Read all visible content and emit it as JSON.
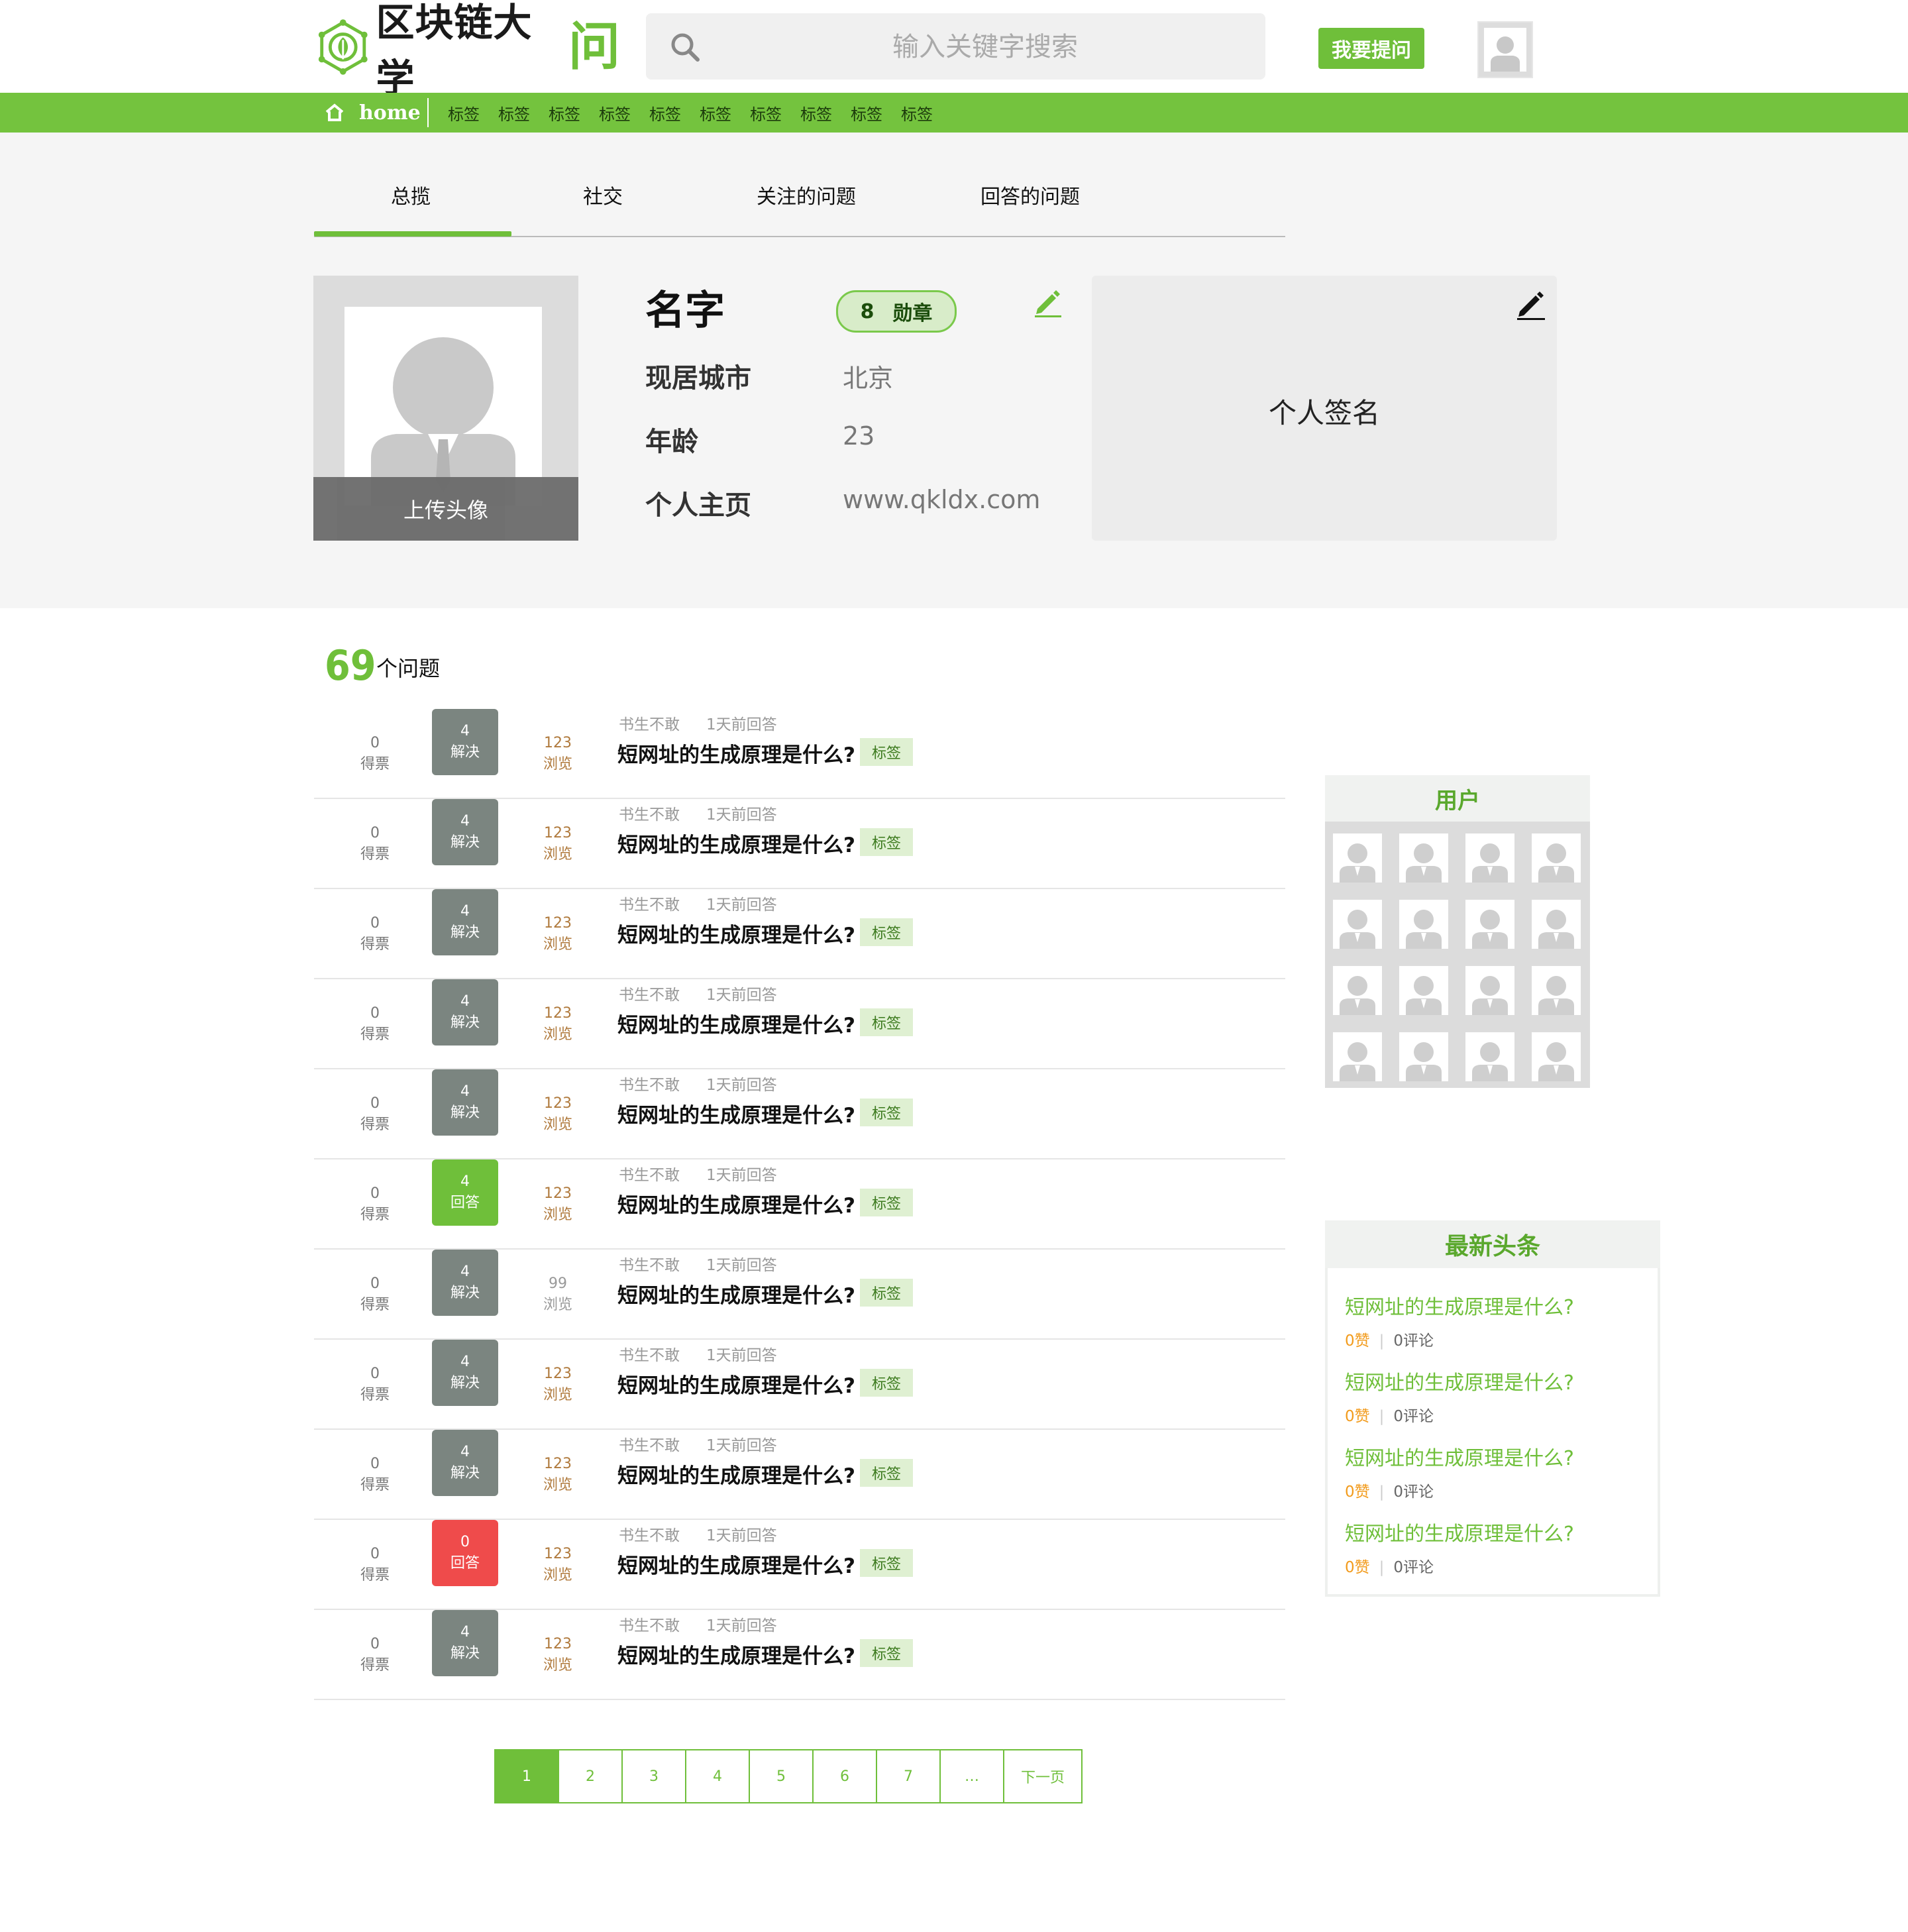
{
  "header": {
    "logo_text": "区块链大学",
    "logo_accent": "问",
    "search_placeholder": "输入关键字搜索",
    "ask_button": "我要提问"
  },
  "nav": {
    "home_label": "home",
    "tags": [
      "标签",
      "标签",
      "标签",
      "标签",
      "标签",
      "标签",
      "标签",
      "标签",
      "标签",
      "标签"
    ]
  },
  "tabs": [
    "总揽",
    "社交",
    "关注的问题",
    "回答的问题"
  ],
  "profile": {
    "name": "名字",
    "badge_count": "8",
    "badge_label": "勋章",
    "upload_label": "上传头像",
    "city_label": "现居城市",
    "city_value": "北京",
    "age_label": "年龄",
    "age_value": "23",
    "homepage_label": "个人主页",
    "homepage_value": "www.qkldx.com",
    "signature": "个人签名"
  },
  "questions": {
    "count": "69",
    "count_label": "个问题",
    "items": [
      {
        "votes": "0",
        "votes_label": "得票",
        "answers": "4",
        "answers_label": "解决",
        "status": "solved",
        "views": "123",
        "views_label": "浏览",
        "author": "书生不敢",
        "time": "1天前回答",
        "title": "短网址的生成原理是什么?",
        "tag": "标签"
      },
      {
        "votes": "0",
        "votes_label": "得票",
        "answers": "4",
        "answers_label": "解决",
        "status": "solved",
        "views": "123",
        "views_label": "浏览",
        "author": "书生不敢",
        "time": "1天前回答",
        "title": "短网址的生成原理是什么?",
        "tag": "标签"
      },
      {
        "votes": "0",
        "votes_label": "得票",
        "answers": "4",
        "answers_label": "解决",
        "status": "solved",
        "views": "123",
        "views_label": "浏览",
        "author": "书生不敢",
        "time": "1天前回答",
        "title": "短网址的生成原理是什么?",
        "tag": "标签"
      },
      {
        "votes": "0",
        "votes_label": "得票",
        "answers": "4",
        "answers_label": "解决",
        "status": "solved",
        "views": "123",
        "views_label": "浏览",
        "author": "书生不敢",
        "time": "1天前回答",
        "title": "短网址的生成原理是什么?",
        "tag": "标签"
      },
      {
        "votes": "0",
        "votes_label": "得票",
        "answers": "4",
        "answers_label": "解决",
        "status": "solved",
        "views": "123",
        "views_label": "浏览",
        "author": "书生不敢",
        "time": "1天前回答",
        "title": "短网址的生成原理是什么?",
        "tag": "标签"
      },
      {
        "votes": "0",
        "votes_label": "得票",
        "answers": "4",
        "answers_label": "回答",
        "status": "answered",
        "views": "123",
        "views_label": "浏览",
        "author": "书生不敢",
        "time": "1天前回答",
        "title": "短网址的生成原理是什么?",
        "tag": "标签"
      },
      {
        "votes": "0",
        "votes_label": "得票",
        "answers": "4",
        "answers_label": "解决",
        "status": "solved",
        "views": "99",
        "views_label": "浏览",
        "author": "书生不敢",
        "time": "1天前回答",
        "title": "短网址的生成原理是什么?",
        "tag": "标签"
      },
      {
        "votes": "0",
        "votes_label": "得票",
        "answers": "4",
        "answers_label": "解决",
        "status": "solved",
        "views": "123",
        "views_label": "浏览",
        "author": "书生不敢",
        "time": "1天前回答",
        "title": "短网址的生成原理是什么?",
        "tag": "标签"
      },
      {
        "votes": "0",
        "votes_label": "得票",
        "answers": "4",
        "answers_label": "解决",
        "status": "solved",
        "views": "123",
        "views_label": "浏览",
        "author": "书生不敢",
        "time": "1天前回答",
        "title": "短网址的生成原理是什么?",
        "tag": "标签"
      },
      {
        "votes": "0",
        "votes_label": "得票",
        "answers": "0",
        "answers_label": "回答",
        "status": "unanswered",
        "views": "123",
        "views_label": "浏览",
        "author": "书生不敢",
        "time": "1天前回答",
        "title": "短网址的生成原理是什么?",
        "tag": "标签"
      },
      {
        "votes": "0",
        "votes_label": "得票",
        "answers": "4",
        "answers_label": "解决",
        "status": "solved",
        "views": "123",
        "views_label": "浏览",
        "author": "书生不敢",
        "time": "1天前回答",
        "title": "短网址的生成原理是什么?",
        "tag": "标签"
      }
    ]
  },
  "pagination": {
    "pages": [
      "1",
      "2",
      "3",
      "4",
      "5",
      "6",
      "7",
      "…",
      "下一页"
    ],
    "active": "1"
  },
  "sidebar": {
    "users_title": "用户",
    "user_count": 16,
    "news_title": "最新头条",
    "news": [
      {
        "title": "短网址的生成原理是什么?",
        "likes": "0赞",
        "comments": "0评论"
      },
      {
        "title": "短网址的生成原理是什么?",
        "likes": "0赞",
        "comments": "0评论"
      },
      {
        "title": "短网址的生成原理是什么?",
        "likes": "0赞",
        "comments": "0评论"
      },
      {
        "title": "短网址的生成原理是什么?",
        "likes": "0赞",
        "comments": "0评论"
      }
    ]
  },
  "colors": {
    "accent": "#6fbf3a",
    "nav_bar": "#74c33e",
    "solved": "#7b8580",
    "answered": "#6fbf3a",
    "unanswered": "#ef4b4b",
    "views": "#b07a3d",
    "likes": "#f29b1c"
  }
}
